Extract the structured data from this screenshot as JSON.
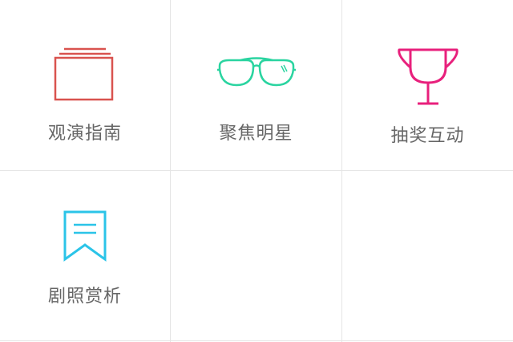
{
  "menu": {
    "items": [
      {
        "label": "观演指南",
        "icon": "screen-frame-icon",
        "color": "#d9534f"
      },
      {
        "label": "聚焦明星",
        "icon": "sunglasses-icon",
        "color": "#2ad4a0"
      },
      {
        "label": "抽奖互动",
        "icon": "trophy-icon",
        "color": "#e8207c"
      },
      {
        "label": "剧照赏析",
        "icon": "bookmark-icon",
        "color": "#2bc4e8"
      }
    ]
  }
}
